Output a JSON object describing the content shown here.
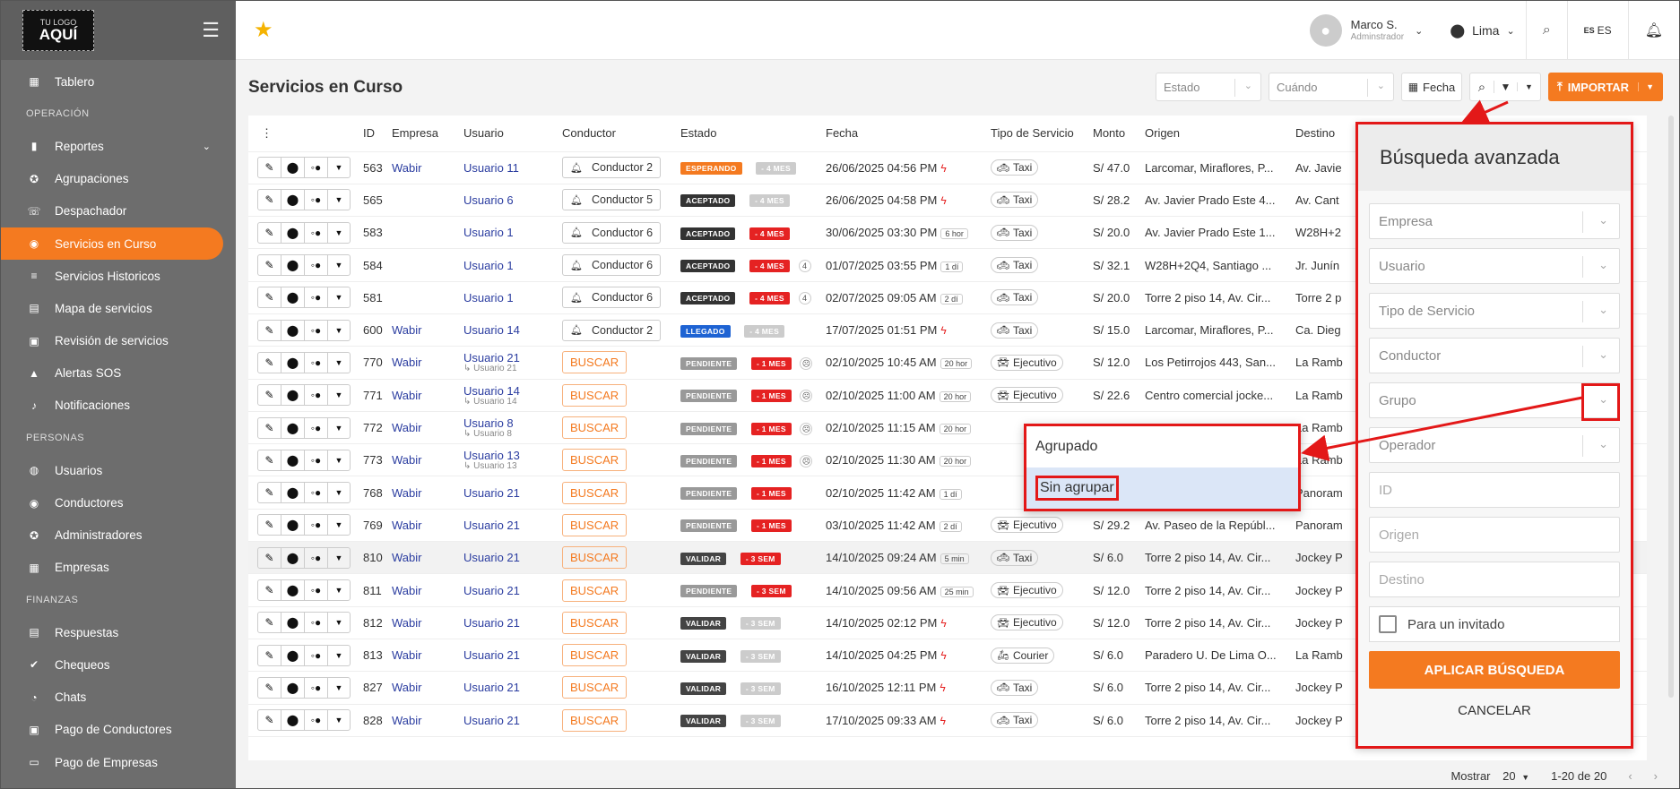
{
  "logo": {
    "top": "TU LOGO",
    "main": "AQUÍ"
  },
  "sidebar": {
    "items": [
      {
        "type": "item",
        "label": "Tablero",
        "icon": "dashboard-icon"
      },
      {
        "type": "section",
        "label": "OPERACIÓN"
      },
      {
        "type": "item",
        "label": "Reportes",
        "icon": "bar-chart-icon",
        "chevron": "⌄"
      },
      {
        "type": "item",
        "label": "Agrupaciones",
        "icon": "group-icon"
      },
      {
        "type": "item",
        "label": "Despachador",
        "icon": "phone-icon"
      },
      {
        "type": "item",
        "label": "Servicios en Curso",
        "icon": "dot-circle-icon",
        "active": true
      },
      {
        "type": "item",
        "label": "Servicios Historicos",
        "icon": "history-icon"
      },
      {
        "type": "item",
        "label": "Mapa de servicios",
        "icon": "map-icon"
      },
      {
        "type": "item",
        "label": "Revisión de servicios",
        "icon": "review-icon"
      },
      {
        "type": "item",
        "label": "Alertas SOS",
        "icon": "warning-icon"
      },
      {
        "type": "item",
        "label": "Notificaciones",
        "icon": "bell-icon"
      },
      {
        "type": "section",
        "label": "PERSONAS"
      },
      {
        "type": "item",
        "label": "Usuarios",
        "icon": "users-icon"
      },
      {
        "type": "item",
        "label": "Conductores",
        "icon": "driver-icon"
      },
      {
        "type": "item",
        "label": "Administradores",
        "icon": "admin-icon"
      },
      {
        "type": "item",
        "label": "Empresas",
        "icon": "building-icon"
      },
      {
        "type": "section",
        "label": "FINANZAS"
      },
      {
        "type": "item",
        "label": "Respuestas",
        "icon": "reply-icon"
      },
      {
        "type": "item",
        "label": "Chequeos",
        "icon": "check-icon"
      },
      {
        "type": "item",
        "label": "Chats",
        "icon": "chat-icon"
      },
      {
        "type": "item",
        "label": "Pago de Conductores",
        "icon": "payment-icon"
      },
      {
        "type": "item",
        "label": "Pago de Empresas",
        "icon": "card-icon"
      }
    ]
  },
  "topbar": {
    "user_name": "Marco S.",
    "user_role": "Adminstrador",
    "city": "Lima",
    "lang": "ES",
    "lang_flag": "ES"
  },
  "page": {
    "title": "Servicios en Curso",
    "filter_estado": "Estado",
    "filter_cuando": "Cuándo",
    "fecha_label": "Fecha",
    "importar_label": "IMPORTAR"
  },
  "table": {
    "headers": [
      "ID",
      "Empresa",
      "Usuario",
      "Conductor",
      "Estado",
      "Fecha",
      "Tipo de Servicio",
      "Monto",
      "Origen",
      "Destino"
    ],
    "rows": [
      {
        "id": "563",
        "empresa": "Wabir",
        "usuario": "Usuario 11",
        "usuario_sub": "",
        "conductor": "Conductor 2",
        "estado": "ESPERANDO",
        "estado_color": "#f47a20",
        "age": "- 4 MES",
        "age_color": "#cccccc",
        "count": "",
        "fecha": "26/06/2025 04:56 PM",
        "dur": "",
        "bolt": true,
        "servicio": "Taxi",
        "monto": "S/ 47.0",
        "origen": "Larcomar, Miraflores, P...",
        "destino": "Av. Javie",
        "hl": false
      },
      {
        "id": "565",
        "empresa": "",
        "usuario": "Usuario 6",
        "usuario_sub": "",
        "conductor": "Conductor 5",
        "estado": "ACEPTADO",
        "estado_color": "#333333",
        "age": "- 4 MES",
        "age_color": "#cccccc",
        "count": "",
        "fecha": "26/06/2025 04:58 PM",
        "dur": "",
        "bolt": true,
        "servicio": "Taxi",
        "monto": "S/ 28.2",
        "origen": "Av. Javier Prado Este 4...",
        "destino": "Av. Cant",
        "hl": false
      },
      {
        "id": "583",
        "empresa": "",
        "usuario": "Usuario 1",
        "usuario_sub": "",
        "conductor": "Conductor 6",
        "estado": "ACEPTADO",
        "estado_color": "#333333",
        "age": "- 4 MES",
        "age_color": "#e52222",
        "count": "",
        "fecha": "30/06/2025 03:30 PM",
        "dur": "6 hor",
        "bolt": false,
        "servicio": "Taxi",
        "monto": "S/ 20.0",
        "origen": "Av. Javier Prado Este 1...",
        "destino": "W28H+2",
        "hl": false
      },
      {
        "id": "584",
        "empresa": "",
        "usuario": "Usuario 1",
        "usuario_sub": "",
        "conductor": "Conductor 6",
        "estado": "ACEPTADO",
        "estado_color": "#333333",
        "age": "- 4 MES",
        "age_color": "#e52222",
        "count": "4",
        "fecha": "01/07/2025 03:55 PM",
        "dur": "1 dí",
        "bolt": false,
        "servicio": "Taxi",
        "monto": "S/ 32.1",
        "origen": "W28H+2Q4, Santiago ...",
        "destino": "Jr. Junín",
        "hl": false
      },
      {
        "id": "581",
        "empresa": "",
        "usuario": "Usuario 1",
        "usuario_sub": "",
        "conductor": "Conductor 6",
        "estado": "ACEPTADO",
        "estado_color": "#333333",
        "age": "- 4 MES",
        "age_color": "#e52222",
        "count": "4",
        "fecha": "02/07/2025 09:05 AM",
        "dur": "2 dí",
        "bolt": false,
        "servicio": "Taxi",
        "monto": "S/ 20.0",
        "origen": "Torre 2 piso 14, Av. Cir...",
        "destino": "Torre 2 p",
        "hl": false
      },
      {
        "id": "600",
        "empresa": "Wabir",
        "usuario": "Usuario 14",
        "usuario_sub": "",
        "conductor": "Conductor 2",
        "estado": "LLEGADO",
        "estado_color": "#1e63d3",
        "age": "- 4 MES",
        "age_color": "#cccccc",
        "count": "",
        "fecha": "17/07/2025 01:51 PM",
        "dur": "",
        "bolt": true,
        "servicio": "Taxi",
        "monto": "S/ 15.0",
        "origen": "Larcomar, Miraflores, P...",
        "destino": "Ca. Dieg",
        "hl": false
      },
      {
        "id": "770",
        "empresa": "Wabir",
        "usuario": "Usuario 21",
        "usuario_sub": "↳ Usuario 21",
        "conductor": "",
        "estado": "PENDIENTE",
        "estado_color": "#999999",
        "age": "- 1 MES",
        "age_color": "#e52222",
        "count": "☹",
        "fecha": "02/10/2025 10:45 AM",
        "dur": "20 hor",
        "bolt": false,
        "servicio": "Ejecutivo",
        "monto": "S/ 12.0",
        "origen": "Los Petirrojos 443, San...",
        "destino": "La Ramb",
        "hl": false
      },
      {
        "id": "771",
        "empresa": "Wabir",
        "usuario": "Usuario 14",
        "usuario_sub": "↳ Usuario 14",
        "conductor": "",
        "estado": "PENDIENTE",
        "estado_color": "#999999",
        "age": "- 1 MES",
        "age_color": "#e52222",
        "count": "☹",
        "fecha": "02/10/2025 11:00 AM",
        "dur": "20 hor",
        "bolt": false,
        "servicio": "Ejecutivo",
        "monto": "S/ 22.6",
        "origen": "Centro comercial jocke...",
        "destino": "La Ramb",
        "hl": false
      },
      {
        "id": "772",
        "empresa": "Wabir",
        "usuario": "Usuario 8",
        "usuario_sub": "↳ Usuario 8",
        "conductor": "",
        "estado": "PENDIENTE",
        "estado_color": "#999999",
        "age": "- 1 MES",
        "age_color": "#e52222",
        "count": "☹",
        "fecha": "02/10/2025 11:15 AM",
        "dur": "20 hor",
        "bolt": false,
        "servicio": "",
        "monto": "",
        "origen": "",
        "destino": "La Ramb",
        "hl": false
      },
      {
        "id": "773",
        "empresa": "Wabir",
        "usuario": "Usuario 13",
        "usuario_sub": "↳ Usuario 13",
        "conductor": "",
        "estado": "PENDIENTE",
        "estado_color": "#999999",
        "age": "- 1 MES",
        "age_color": "#e52222",
        "count": "☹",
        "fecha": "02/10/2025 11:30 AM",
        "dur": "20 hor",
        "bolt": false,
        "servicio": "",
        "monto": "",
        "origen": "",
        "destino": "La Ramb",
        "hl": false
      },
      {
        "id": "768",
        "empresa": "Wabir",
        "usuario": "Usuario 21",
        "usuario_sub": "",
        "conductor": "",
        "estado": "PENDIENTE",
        "estado_color": "#999999",
        "age": "- 1 MES",
        "age_color": "#e52222",
        "count": "",
        "fecha": "02/10/2025 11:42 AM",
        "dur": "1 dí",
        "bolt": false,
        "servicio": "",
        "monto": "",
        "origen": "",
        "destino": "Panoram",
        "hl": false
      },
      {
        "id": "769",
        "empresa": "Wabir",
        "usuario": "Usuario 21",
        "usuario_sub": "",
        "conductor": "",
        "estado": "PENDIENTE",
        "estado_color": "#999999",
        "age": "- 1 MES",
        "age_color": "#e52222",
        "count": "",
        "fecha": "03/10/2025 11:42 AM",
        "dur": "2 dí",
        "bolt": false,
        "servicio": "Ejecutivo",
        "monto": "S/ 29.2",
        "origen": "Av. Paseo de la Repúbl...",
        "destino": "Panoram",
        "hl": false
      },
      {
        "id": "810",
        "empresa": "Wabir",
        "usuario": "Usuario 21",
        "usuario_sub": "",
        "conductor": "",
        "estado": "VALIDAR",
        "estado_color": "#444444",
        "age": "- 3 SEM",
        "age_color": "#e52222",
        "count": "",
        "fecha": "14/10/2025 09:24 AM",
        "dur": "5 min",
        "bolt": false,
        "servicio": "Taxi",
        "monto": "S/ 6.0",
        "origen": "Torre 2 piso 14, Av. Cir...",
        "destino": "Jockey P",
        "hl": true
      },
      {
        "id": "811",
        "empresa": "Wabir",
        "usuario": "Usuario 21",
        "usuario_sub": "",
        "conductor": "",
        "estado": "PENDIENTE",
        "estado_color": "#999999",
        "age": "- 3 SEM",
        "age_color": "#e52222",
        "count": "",
        "fecha": "14/10/2025 09:56 AM",
        "dur": "25 min",
        "bolt": false,
        "servicio": "Ejecutivo",
        "monto": "S/ 12.0",
        "origen": "Torre 2 piso 14, Av. Cir...",
        "destino": "Jockey P",
        "hl": false
      },
      {
        "id": "812",
        "empresa": "Wabir",
        "usuario": "Usuario 21",
        "usuario_sub": "",
        "conductor": "",
        "estado": "VALIDAR",
        "estado_color": "#444444",
        "age": "- 3 SEM",
        "age_color": "#cccccc",
        "count": "",
        "fecha": "14/10/2025 02:12 PM",
        "dur": "",
        "bolt": true,
        "servicio": "Ejecutivo",
        "monto": "S/ 12.0",
        "origen": "Torre 2 piso 14, Av. Cir...",
        "destino": "Jockey P",
        "hl": false
      },
      {
        "id": "813",
        "empresa": "Wabir",
        "usuario": "Usuario 21",
        "usuario_sub": "",
        "conductor": "",
        "estado": "VALIDAR",
        "estado_color": "#444444",
        "age": "- 3 SEM",
        "age_color": "#cccccc",
        "count": "",
        "fecha": "14/10/2025 04:25 PM",
        "dur": "",
        "bolt": true,
        "servicio": "Courier",
        "monto": "S/ 6.0",
        "origen": "Paradero U. De Lima O...",
        "destino": "La Ramb",
        "hl": false
      },
      {
        "id": "827",
        "empresa": "Wabir",
        "usuario": "Usuario 21",
        "usuario_sub": "",
        "conductor": "",
        "estado": "VALIDAR",
        "estado_color": "#444444",
        "age": "- 3 SEM",
        "age_color": "#cccccc",
        "count": "",
        "fecha": "16/10/2025 12:11 PM",
        "dur": "",
        "bolt": true,
        "servicio": "Taxi",
        "monto": "S/ 6.0",
        "origen": "Torre 2 piso 14, Av. Cir...",
        "destino": "Jockey P",
        "hl": false
      },
      {
        "id": "828",
        "empresa": "Wabir",
        "usuario": "Usuario 21",
        "usuario_sub": "",
        "conductor": "",
        "estado": "VALIDAR",
        "estado_color": "#444444",
        "age": "- 3 SEM",
        "age_color": "#cccccc",
        "count": "",
        "fecha": "17/10/2025 09:33 AM",
        "dur": "",
        "bolt": true,
        "servicio": "Taxi",
        "monto": "S/ 6.0",
        "origen": "Torre 2 piso 14, Av. Cir...",
        "destino": "Jockey P",
        "hl": false
      }
    ],
    "buscar_label": "BUSCAR"
  },
  "footer": {
    "show_label": "Mostrar",
    "page_size": "20",
    "range": "1-20 de 20"
  },
  "advanced": {
    "title": "Búsqueda avanzada",
    "fields": [
      "Empresa",
      "Usuario",
      "Tipo de Servicio",
      "Conductor",
      "Grupo",
      "Operador"
    ],
    "inputs": [
      "ID",
      "Origen",
      "Destino"
    ],
    "guest_label": "Para un invitado",
    "apply_label": "APLICAR BÚSQUEDA",
    "cancel_label": "CANCELAR"
  },
  "group_dropdown": {
    "options": [
      "Agrupado",
      "Sin agrupar"
    ],
    "highlighted": "Sin agrupar"
  },
  "colors": {
    "accent": "#f47a20",
    "annotation": "#e31818",
    "sidebar": "#6d6d6d"
  }
}
